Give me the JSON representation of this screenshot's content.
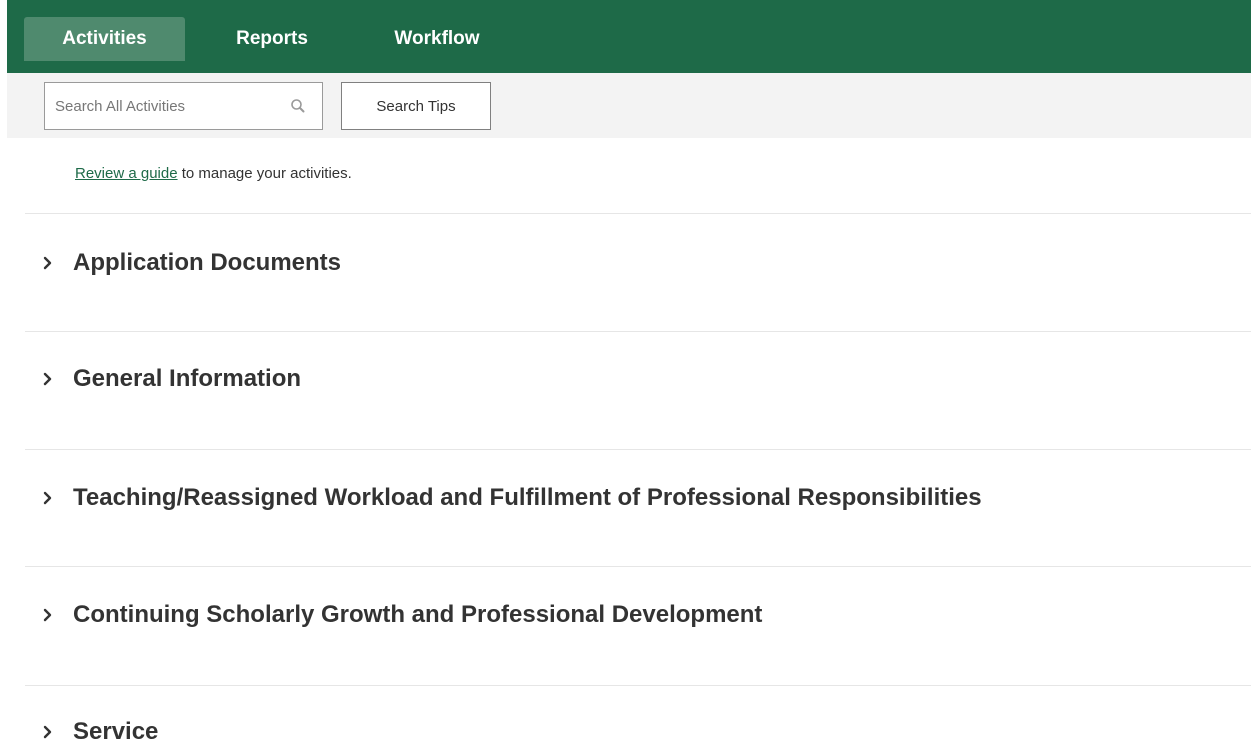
{
  "nav": {
    "tabs": [
      {
        "label": "Activities",
        "active": true
      },
      {
        "label": "Reports",
        "active": false
      },
      {
        "label": "Workflow",
        "active": false
      }
    ]
  },
  "search": {
    "placeholder": "Search All Activities",
    "value": "",
    "tips_label": "Search Tips"
  },
  "guide": {
    "link_text": "Review a guide",
    "rest_text": " to manage your activities."
  },
  "sections": [
    {
      "title": "Application Documents"
    },
    {
      "title": "General Information"
    },
    {
      "title": "Teaching/Reassigned Workload and Fulfillment of Professional Responsibilities"
    },
    {
      "title": "Continuing Scholarly Growth and Professional Development"
    },
    {
      "title": "Service"
    }
  ],
  "colors": {
    "nav_bg": "#1e6a48",
    "nav_active_bg": "#4f8a6e",
    "search_bar_bg": "#f3f3f3",
    "link": "#1e6a48",
    "text": "#333333"
  },
  "icons": {
    "search": "search-icon",
    "section_toggle": "chevron-right-icon"
  }
}
